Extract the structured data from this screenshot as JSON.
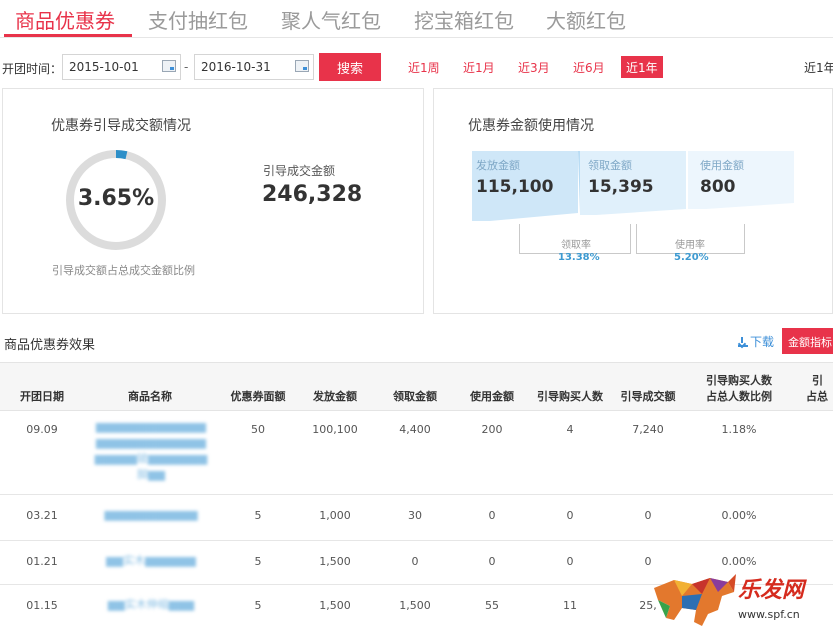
{
  "tabs": [
    {
      "label": "商品优惠券",
      "active": true
    },
    {
      "label": "支付抽红包",
      "active": false
    },
    {
      "label": "聚人气红包",
      "active": false
    },
    {
      "label": "挖宝箱红包",
      "active": false
    },
    {
      "label": "大额红包",
      "active": false
    }
  ],
  "filter": {
    "label": "开团时间：",
    "start_date": "2015-10-01",
    "end_date": "2016-10-31",
    "separator": "-",
    "search_label": "搜索",
    "ranges": [
      {
        "label": "近1周",
        "active": false
      },
      {
        "label": "近1月",
        "active": false
      },
      {
        "label": "近3月",
        "active": false
      },
      {
        "label": "近6月",
        "active": false
      },
      {
        "label": "近1年",
        "active": true
      }
    ],
    "right_label": "近1年"
  },
  "conversion_panel": {
    "title": "优惠券引导成交额情况",
    "ratio_label": "3.65%",
    "ratio_value": 0.0365,
    "ratio_caption": "引导成交额占总成交金额比例",
    "gmv_label": "引导成交金额",
    "gmv_value": "246,328"
  },
  "usage_panel": {
    "title": "优惠券金额使用情况",
    "issued_label": "发放金额",
    "issued_value": "115,100",
    "claimed_label": "领取金额",
    "claimed_value": "15,395",
    "used_label": "使用金额",
    "used_value": "800",
    "claim_rate_label": "领取率",
    "claim_rate_value": "13.38%",
    "use_rate_label": "使用率",
    "use_rate_value": "5.20%"
  },
  "effect": {
    "title": "商品优惠券效果",
    "download_label": "下载",
    "metric_label": "金额指标"
  },
  "table": {
    "headers": [
      "开团日期",
      "商品名称",
      "优惠券面额",
      "发放金额",
      "领取金额",
      "使用金额",
      "引导购买人数",
      "引导成交额",
      "引导购买人数占总人数比例",
      "引导成交额占总成交额比例"
    ],
    "header_lines": [
      [
        "开团日期"
      ],
      [
        "商品名称"
      ],
      [
        "优惠券面额"
      ],
      [
        "发放金额"
      ],
      [
        "领取金额"
      ],
      [
        "使用金额"
      ],
      [
        "引导购买人数"
      ],
      [
        "引导成交额"
      ],
      [
        "引导购买人数",
        "占总人数比例"
      ],
      [
        "引",
        "占总"
      ]
    ],
    "rows": [
      {
        "date": "09.09",
        "name_lines": [
          "▆▆▆▆▆▆▆▆▆▆▆▆▆",
          "▆▆▆▆▆▆▆▆▆▆▆▆▆",
          "▆▆▆▆▆玻▆▆▆▆▆▆▆",
          "脚▆▆"
        ],
        "face": "50",
        "issued": "100,100",
        "claimed": "4,400",
        "used": "200",
        "buyers": "4",
        "gmv": "7,240",
        "ratio": "1.18%"
      },
      {
        "date": "03.21",
        "name_lines": [
          "▆▆▆▆▆▆▆▆▆▆▆"
        ],
        "face": "5",
        "issued": "1,000",
        "claimed": "30",
        "used": "0",
        "buyers": "0",
        "gmv": "0",
        "ratio": "0.00%"
      },
      {
        "date": "01.21",
        "name_lines": [
          "▆▆实木▆▆▆▆▆▆"
        ],
        "face": "5",
        "issued": "1,500",
        "claimed": "0",
        "used": "0",
        "buyers": "0",
        "gmv": "0",
        "ratio": "0.00%"
      },
      {
        "date": "01.15",
        "name_lines": [
          "▆▆实木伸缩▆▆▆"
        ],
        "face": "5",
        "issued": "1,500",
        "claimed": "1,500",
        "used": "55",
        "buyers": "11",
        "gmv": "25,",
        "ratio": ""
      }
    ]
  },
  "watermark": {
    "text": "乐发网",
    "url": "www.spf.cn"
  },
  "colors": {
    "accent": "#e8334a",
    "donut_track": "#dcdcdc",
    "donut_fill": "#2d8fc8",
    "coupon_fill": "#d6ecfb",
    "rate_text": "#3d9ad1"
  }
}
